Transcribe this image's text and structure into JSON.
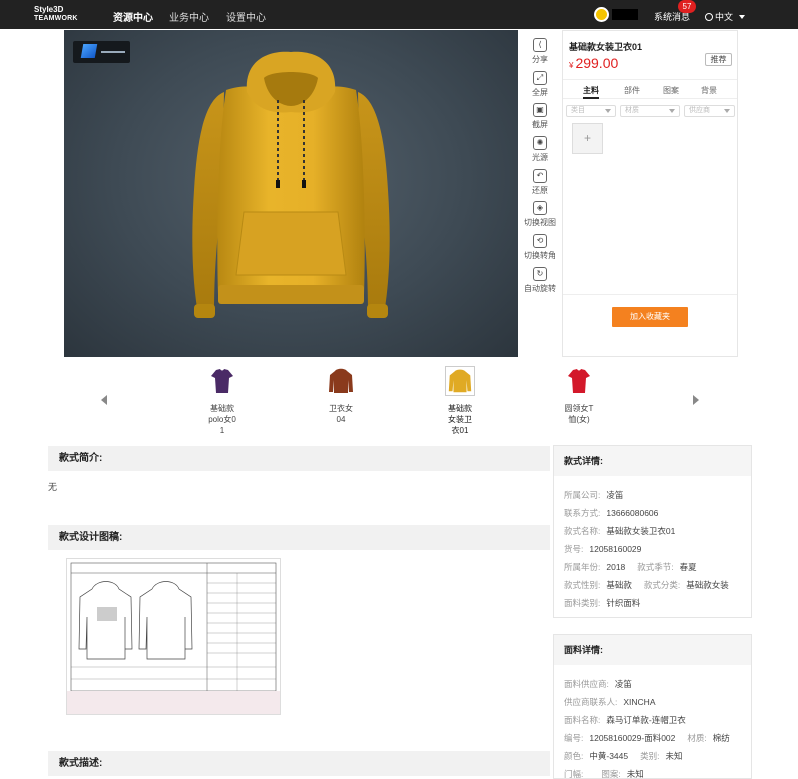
{
  "topbar": {
    "logo_line1": "Style3D",
    "logo_line2": "TEAMWORK",
    "nav": [
      "资源中心",
      "业务中心",
      "设置中心"
    ],
    "active_nav": 0,
    "system_msg": "系统消息",
    "msg_count": "57",
    "language": "中文"
  },
  "toolbar": [
    {
      "label": "分享",
      "icon": "share-icon"
    },
    {
      "label": "全屏",
      "icon": "fullscreen-icon"
    },
    {
      "label": "截屏",
      "icon": "screenshot-icon"
    },
    {
      "label": "光源",
      "icon": "light-icon"
    },
    {
      "label": "还原",
      "icon": "undo-icon"
    },
    {
      "label": "切换视图",
      "icon": "view-icon"
    },
    {
      "label": "切换转角",
      "icon": "rotate-icon"
    },
    {
      "label": "自动旋转",
      "icon": "autorotate-icon"
    }
  ],
  "product": {
    "name": "基础款女装卫衣01",
    "currency": "¥",
    "price": "299.00",
    "recommend": "推荐",
    "tabs": [
      "主料",
      "部件",
      "图案",
      "背景"
    ],
    "active_tab": 0,
    "filters": [
      "类目",
      "材质",
      "供应商"
    ],
    "add_symbol": "+",
    "favorite": "加入收藏夹"
  },
  "colors": {
    "accent": "#f4811f",
    "price": "#e02020",
    "garment": "#e0aa24"
  },
  "thumbnails": [
    {
      "label": "基础款polo女01",
      "color": "#4a2a66"
    },
    {
      "label": "卫衣女04",
      "color": "#8a3a1c"
    },
    {
      "label": "基础款女装卫衣01",
      "color": "#e0aa24",
      "selected": true
    },
    {
      "label": "圆领女T恤(女)",
      "color": "#d3182a"
    }
  ],
  "sections": {
    "intro_title": "款式简介:",
    "intro_text": "无",
    "draft_title": "款式设计图稿:",
    "desc_title": "款式描述:"
  },
  "style_detail": {
    "title": "款式详情:",
    "company": {
      "k": "所属公司:",
      "v": "凌笛"
    },
    "contact": {
      "k": "联系方式:",
      "v": "13666080606"
    },
    "style_name": {
      "k": "款式名称:",
      "v": "基础款女装卫衣01"
    },
    "article_no": {
      "k": "货号:",
      "v": "12058160029"
    },
    "year": {
      "k": "所属年份:",
      "v": "2018"
    },
    "season": {
      "k": "款式季节:",
      "v": "春夏"
    },
    "gender": {
      "k": "款式性别:",
      "v": "基础款"
    },
    "category": {
      "k": "款式分类:",
      "v": "基础款女装"
    },
    "fabric_type": {
      "k": "面料类别:",
      "v": "针织面料"
    }
  },
  "fabric_detail": {
    "title": "面料详情:",
    "supplier": {
      "k": "面料供应商:",
      "v": "凌笛"
    },
    "supplier_contact": {
      "k": "供应商联系人:",
      "v": "XINCHA"
    },
    "fabric_name": {
      "k": "面料名称:",
      "v": "森马订单款-连帽卫衣"
    },
    "code": {
      "k": "编号:",
      "v": "12058160029-面料002"
    },
    "material": {
      "k": "材质:",
      "v": "棉纺"
    },
    "color": {
      "k": "颜色:",
      "v": "中黄-3445"
    },
    "category": {
      "k": "类别:",
      "v": "未知"
    },
    "width": {
      "k": "门幅:",
      "v": ""
    },
    "pattern": {
      "k": "图案:",
      "v": "未知"
    }
  }
}
